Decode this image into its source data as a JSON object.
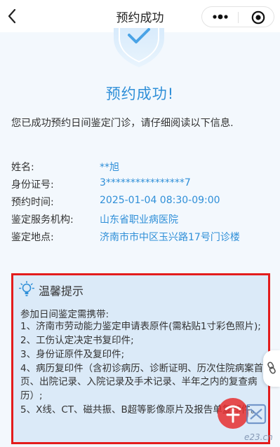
{
  "nav": {
    "back_glyph": "‹",
    "title": "预约成功"
  },
  "hero": {
    "icon": "shield-check-icon",
    "title": "预约成功!"
  },
  "intro": "您已成功预约日间鉴定门诊，请仔细阅读以下信息.",
  "info": [
    {
      "label": "姓名:",
      "value": "**旭"
    },
    {
      "label": "身份证号:",
      "value": "3****************7"
    },
    {
      "label": "预约时间:",
      "value": "2025-01-04 08:30-09:00"
    },
    {
      "label": "鉴定服务机构:",
      "value": "山东省职业病医院"
    },
    {
      "label": "鉴定地点:",
      "value": "济南市市中区玉兴路17号门诊楼"
    }
  ],
  "tips": {
    "title": "温馨提示",
    "lead": "参加日间鉴定需携带:",
    "items": [
      "1、济南市劳动能力鉴定申请表原件(需粘贴1寸彩色照片);",
      "2、工伤认定决定书复印件;",
      "3、身份证原件及复印件;",
      "4、病历复印件（含初诊病历、诊断证明、历次住院病案首页、出院记录、入院记录及手术记录、半年之内的复查病历）;",
      "5、X线、CT、磁共振、B超等影像原片及报告单复印件。"
    ]
  },
  "watermark": {
    "text": "e23.cn",
    "mark": "舜网"
  },
  "colors": {
    "accent": "#2f8fd8",
    "highlight_border": "#e31c1c",
    "tips_bg": "#dbeaf8",
    "page_bg": "#f3f8fd"
  }
}
